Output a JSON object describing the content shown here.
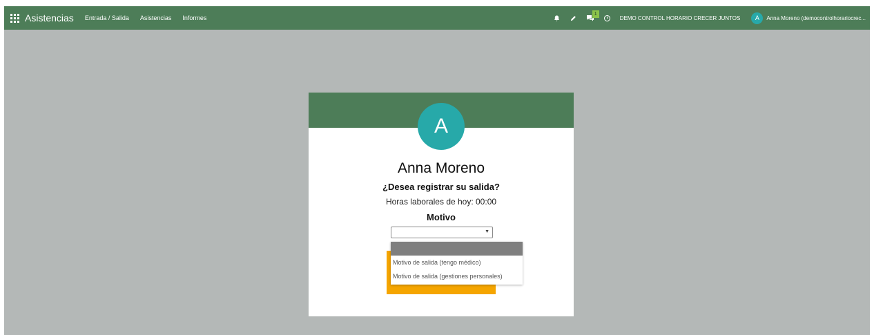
{
  "navbar": {
    "app_title": "Asistencias",
    "menu": [
      "Entrada / Salida",
      "Asistencias",
      "Informes"
    ],
    "icons": [
      "bell-icon",
      "pencil-icon",
      "chat-icon",
      "clock-icon"
    ],
    "messages_badge": "1",
    "company": "DEMO CONTROL HORARIO CRECER JUNTOS",
    "user_initial": "A",
    "user_name": "Anna Moreno (democontrolhorariocrec..."
  },
  "colors": {
    "navbar_bg": "#4d7d58",
    "page_bg": "#b4b8b7",
    "avatar_bg": "#27a9a9",
    "button_bg": "#f5a500"
  },
  "card": {
    "avatar_initial": "A",
    "employee_name": "Anna Moreno",
    "question": "¿Desea registrar su salida?",
    "hours_text": "Horas laborales de hoy: 00:00",
    "reason_label": "Motivo",
    "select_value": "",
    "dropdown_options": [
      "",
      "Motivo de salida (tengo médico)",
      "Motivo de salida (gestiones personales)"
    ]
  }
}
